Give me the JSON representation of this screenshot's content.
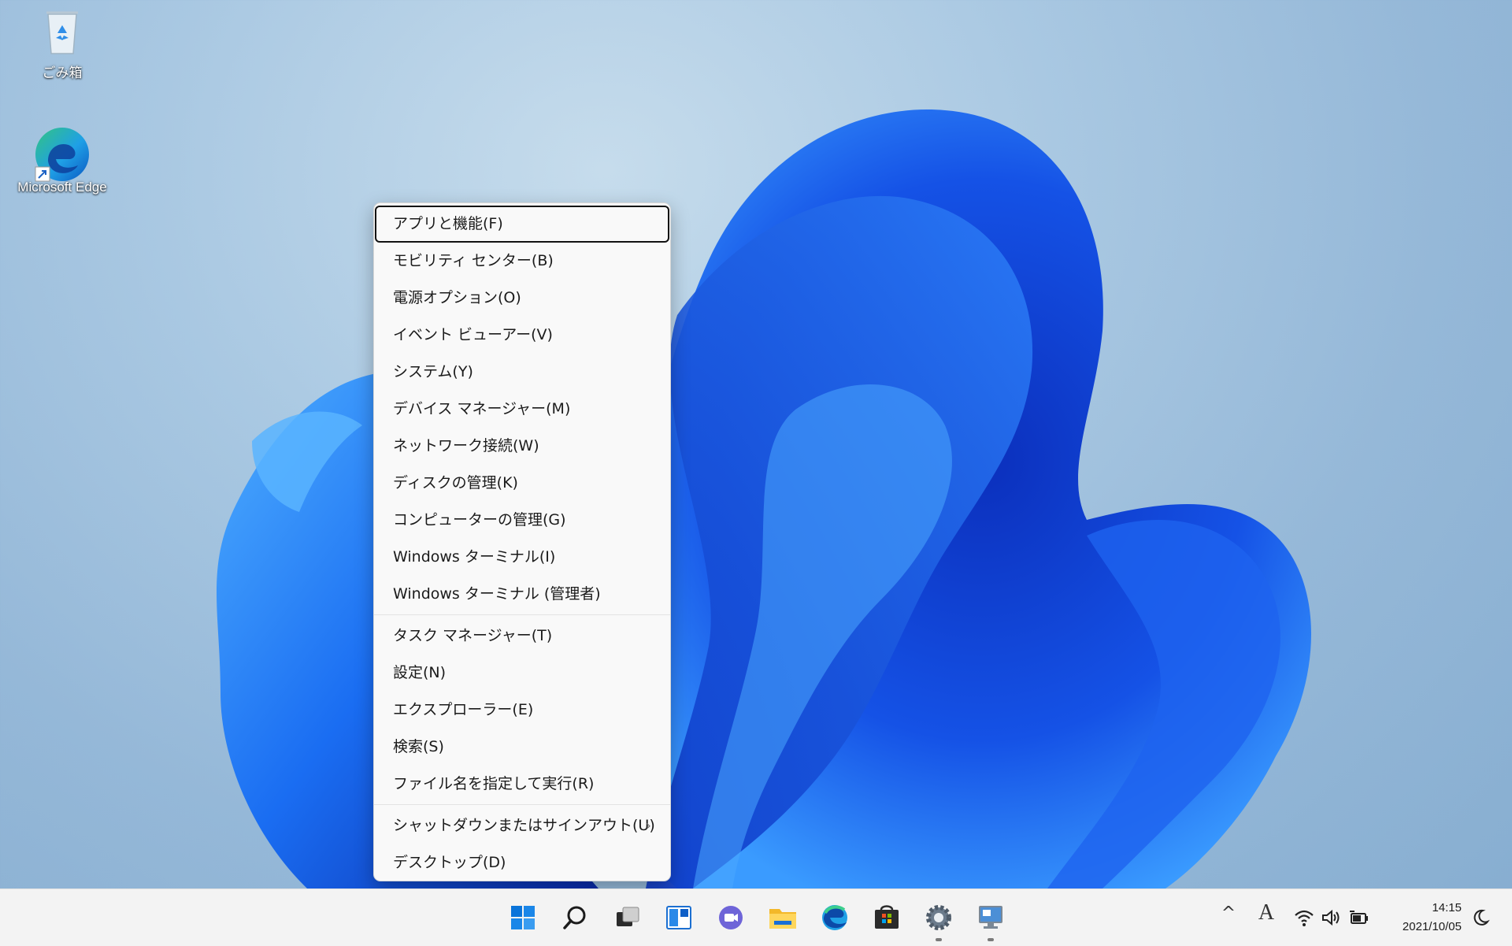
{
  "desktop": {
    "icons": [
      {
        "name": "recycle-bin",
        "label": "ごみ箱"
      },
      {
        "name": "microsoft-edge",
        "label": "Microsoft Edge"
      }
    ]
  },
  "context_menu": {
    "groups": [
      [
        {
          "label": "アプリと機能(F)",
          "focused": true
        },
        {
          "label": "モビリティ センター(B)"
        },
        {
          "label": "電源オプション(O)"
        },
        {
          "label": "イベント ビューアー(V)"
        },
        {
          "label": "システム(Y)"
        },
        {
          "label": "デバイス マネージャー(M)"
        },
        {
          "label": "ネットワーク接続(W)"
        },
        {
          "label": "ディスクの管理(K)"
        },
        {
          "label": "コンピューターの管理(G)"
        },
        {
          "label": "Windows ターミナル(I)"
        },
        {
          "label": "Windows ターミナル (管理者)"
        }
      ],
      [
        {
          "label": "タスク マネージャー(T)"
        },
        {
          "label": "設定(N)"
        },
        {
          "label": "エクスプローラー(E)"
        },
        {
          "label": "検索(S)"
        },
        {
          "label": "ファイル名を指定して実行(R)"
        }
      ],
      [
        {
          "label": "シャットダウンまたはサインアウト(U)",
          "submenu": true
        },
        {
          "label": "デスクトップ(D)"
        }
      ]
    ],
    "submenu_arrow": "›"
  },
  "taskbar": {
    "apps": [
      {
        "icon": "start-icon"
      },
      {
        "icon": "search-icon"
      },
      {
        "icon": "task-view-icon"
      },
      {
        "icon": "widgets-icon"
      },
      {
        "icon": "chat-icon"
      },
      {
        "icon": "file-explorer-icon"
      },
      {
        "icon": "edge-icon"
      },
      {
        "icon": "store-icon"
      },
      {
        "icon": "settings-icon",
        "running": true
      },
      {
        "icon": "remote-desktop-icon",
        "running": true
      }
    ],
    "tray": {
      "chevron": "^",
      "ime": "A",
      "icons": [
        "wifi-icon",
        "volume-icon",
        "battery-icon",
        "focus-assist-icon"
      ]
    },
    "clock": {
      "time": "14:15",
      "date": "2021/10/05"
    }
  },
  "colors": {
    "accent": "#0067c0",
    "bloom_dark": "#0a2fb8",
    "bloom_light": "#2f8cff"
  }
}
